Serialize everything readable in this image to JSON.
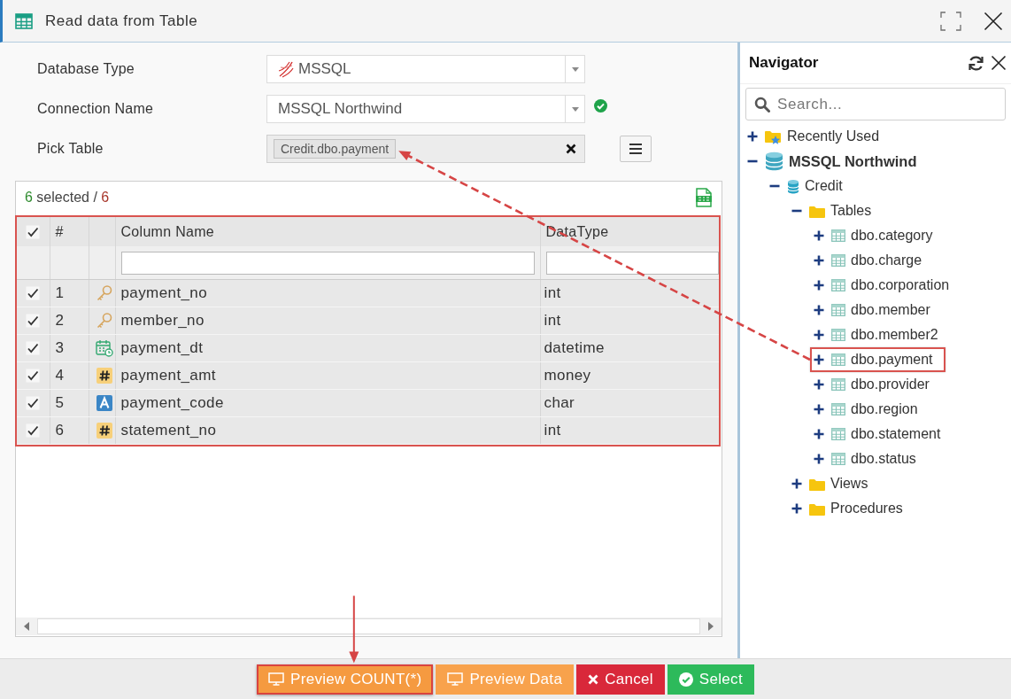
{
  "window": {
    "title": "Read data from Table"
  },
  "form": {
    "fields": [
      {
        "kind": "select",
        "label": "Database Type",
        "value": "MSSQL",
        "logo": true,
        "valid": false
      },
      {
        "kind": "select",
        "label": "Connection Name",
        "value": "MSSQL Northwind",
        "logo": false,
        "valid": true
      },
      {
        "kind": "tags",
        "label": "Pick Table",
        "tags": [
          "Credit.dbo.payment"
        ]
      }
    ]
  },
  "grid": {
    "selected_count": "6",
    "selected_label": "selected /",
    "total_count": "6",
    "highlighted": true,
    "all_checked": true,
    "columns": [
      "#",
      "Column Name",
      "DataType"
    ],
    "rows": [
      {
        "checked": true,
        "number": "1",
        "kind": "key",
        "name": "payment_no",
        "datatype": "int"
      },
      {
        "checked": true,
        "number": "2",
        "kind": "key",
        "name": "member_no",
        "datatype": "int"
      },
      {
        "checked": true,
        "number": "3",
        "kind": "date",
        "name": "payment_dt",
        "datatype": "datetime"
      },
      {
        "checked": true,
        "number": "4",
        "kind": "number",
        "name": "payment_amt",
        "datatype": "money"
      },
      {
        "checked": true,
        "number": "5",
        "kind": "text",
        "name": "payment_code",
        "datatype": "char"
      },
      {
        "checked": true,
        "number": "6",
        "kind": "number",
        "name": "statement_no",
        "datatype": "int"
      }
    ]
  },
  "navigator": {
    "title": "Navigator",
    "search": {
      "placeholder": "Search..."
    },
    "tree": [
      {
        "label": "Recently Used",
        "kind": "recent",
        "expanded": false
      },
      {
        "label": "MSSQL Northwind",
        "kind": "server",
        "expanded": true,
        "children": [
          {
            "label": "Credit",
            "kind": "database",
            "expanded": true,
            "children": [
              {
                "label": "Tables",
                "kind": "folder",
                "expanded": true,
                "children": [
                  {
                    "label": "dbo.category",
                    "kind": "table",
                    "expanded": false,
                    "highlighted": false
                  },
                  {
                    "label": "dbo.charge",
                    "kind": "table",
                    "expanded": false,
                    "highlighted": false
                  },
                  {
                    "label": "dbo.corporation",
                    "kind": "table",
                    "expanded": false,
                    "highlighted": false
                  },
                  {
                    "label": "dbo.member",
                    "kind": "table",
                    "expanded": false,
                    "highlighted": false
                  },
                  {
                    "label": "dbo.member2",
                    "kind": "table",
                    "expanded": false,
                    "highlighted": false
                  },
                  {
                    "label": "dbo.payment",
                    "kind": "table",
                    "expanded": false,
                    "highlighted": true
                  },
                  {
                    "label": "dbo.provider",
                    "kind": "table",
                    "expanded": false,
                    "highlighted": false
                  },
                  {
                    "label": "dbo.region",
                    "kind": "table",
                    "expanded": false,
                    "highlighted": false
                  },
                  {
                    "label": "dbo.statement",
                    "kind": "table",
                    "expanded": false,
                    "highlighted": false
                  },
                  {
                    "label": "dbo.status",
                    "kind": "table",
                    "expanded": false,
                    "highlighted": false
                  }
                ]
              },
              {
                "label": "Views",
                "kind": "folder",
                "expanded": false
              },
              {
                "label": "Procedures",
                "kind": "folder",
                "expanded": false
              }
            ]
          }
        ]
      }
    ]
  },
  "buttons": [
    {
      "kind": "preview",
      "label": "Preview COUNT(*)",
      "highlighted": true
    },
    {
      "kind": "preview",
      "label": "Preview Data",
      "highlighted": false
    },
    {
      "kind": "cancel",
      "label": "Cancel",
      "highlighted": false
    },
    {
      "kind": "confirm",
      "label": "Select",
      "highlighted": false
    }
  ]
}
